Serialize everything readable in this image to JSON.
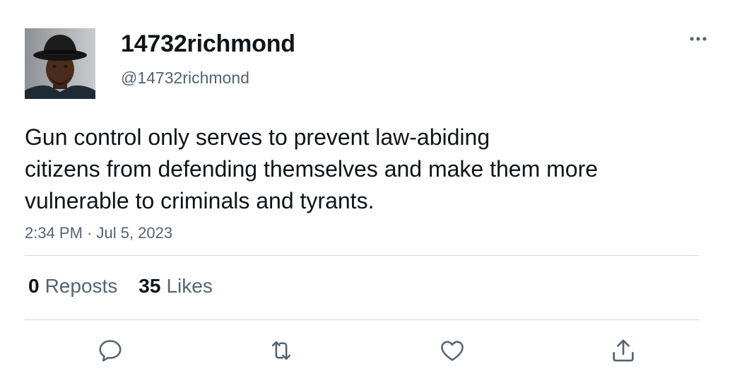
{
  "author": {
    "display_name": "14732richmond",
    "handle": "@14732richmond",
    "avatar_icon": "profile-photo"
  },
  "tweet": {
    "text": "Gun control only serves to prevent law-abiding\ncitizens from defending themselves and make them more\nvulnerable to criminals and tyrants.",
    "timestamp": "2:34 PM · Jul 5, 2023"
  },
  "stats": {
    "reposts_count": "0",
    "reposts_label": "Reposts",
    "likes_count": "35",
    "likes_label": "Likes"
  },
  "actions": [
    {
      "icon": "reply-icon"
    },
    {
      "icon": "repost-icon"
    },
    {
      "icon": "like-icon"
    },
    {
      "icon": "share-icon"
    }
  ],
  "colors": {
    "text_primary": "#0f1419",
    "text_secondary": "#536471",
    "divider": "#cfd9de"
  }
}
